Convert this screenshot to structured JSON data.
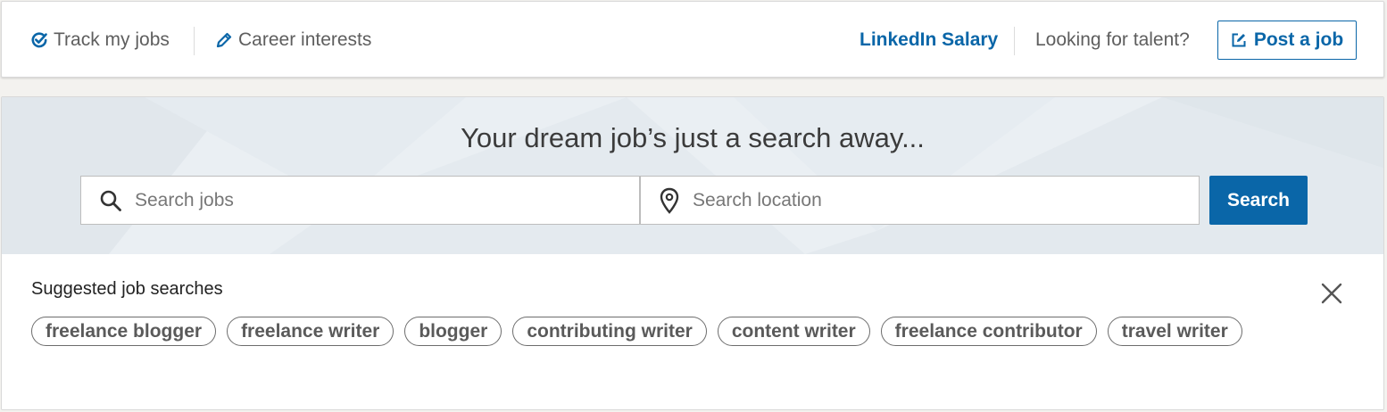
{
  "topbar": {
    "track_label": "Track my jobs",
    "career_label": "Career interests",
    "salary_label": "LinkedIn Salary",
    "talent_label": "Looking for talent?",
    "post_label": "Post a job"
  },
  "hero": {
    "title": "Your dream job’s just a search away...",
    "jobs_placeholder": "Search jobs",
    "location_placeholder": "Search location",
    "search_label": "Search"
  },
  "suggestions": {
    "title": "Suggested job searches",
    "chips": [
      "freelance blogger",
      "freelance writer",
      "blogger",
      "contributing writer",
      "content writer",
      "freelance contributor",
      "travel writer"
    ]
  },
  "icons": {
    "track": "check-circle-icon",
    "career": "pencil-icon",
    "post": "edit-box-icon",
    "jobs": "search-icon",
    "location": "location-pin-icon",
    "close": "close-icon"
  },
  "colors": {
    "brand_blue": "#0a66a8",
    "hero_bg": "#eaeff3"
  }
}
